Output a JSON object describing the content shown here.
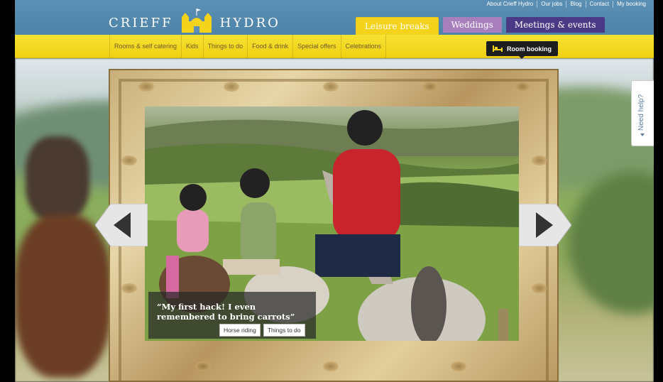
{
  "utility_nav": [
    "About Crieff Hydro",
    "Our jobs",
    "Blog",
    "Contact",
    "My booking"
  ],
  "logo": {
    "left": "CRIEFF",
    "right": "HYDRO",
    "emblem_icon": "castle-icon"
  },
  "main_tabs": [
    {
      "label": "Leisure breaks",
      "color": "#f3d31b",
      "active": true
    },
    {
      "label": "Weddings",
      "color": "#a87fbd"
    },
    {
      "label": "Meetings & events",
      "color": "#4a3a86"
    }
  ],
  "subnav": [
    "Rooms & self catering",
    "Kids",
    "Things to do",
    "Food & drink",
    "Special offers",
    "Celebrations"
  ],
  "room_booking": {
    "label": "Room booking",
    "icon": "bed-icon"
  },
  "carousel": {
    "quote": "“My first hack! I even remembered to bring carrots”",
    "tags": [
      "Horse riding",
      "Things to do"
    ],
    "prev_icon": "chevron-left-icon",
    "next_icon": "chevron-right-icon"
  },
  "need_help": {
    "label": "Need help?",
    "icon": "triangle-left-icon"
  },
  "colors": {
    "header_blue": "#5b8fb3",
    "nav_yellow": "#f0d012",
    "booking_dark": "#1e1e1e"
  }
}
